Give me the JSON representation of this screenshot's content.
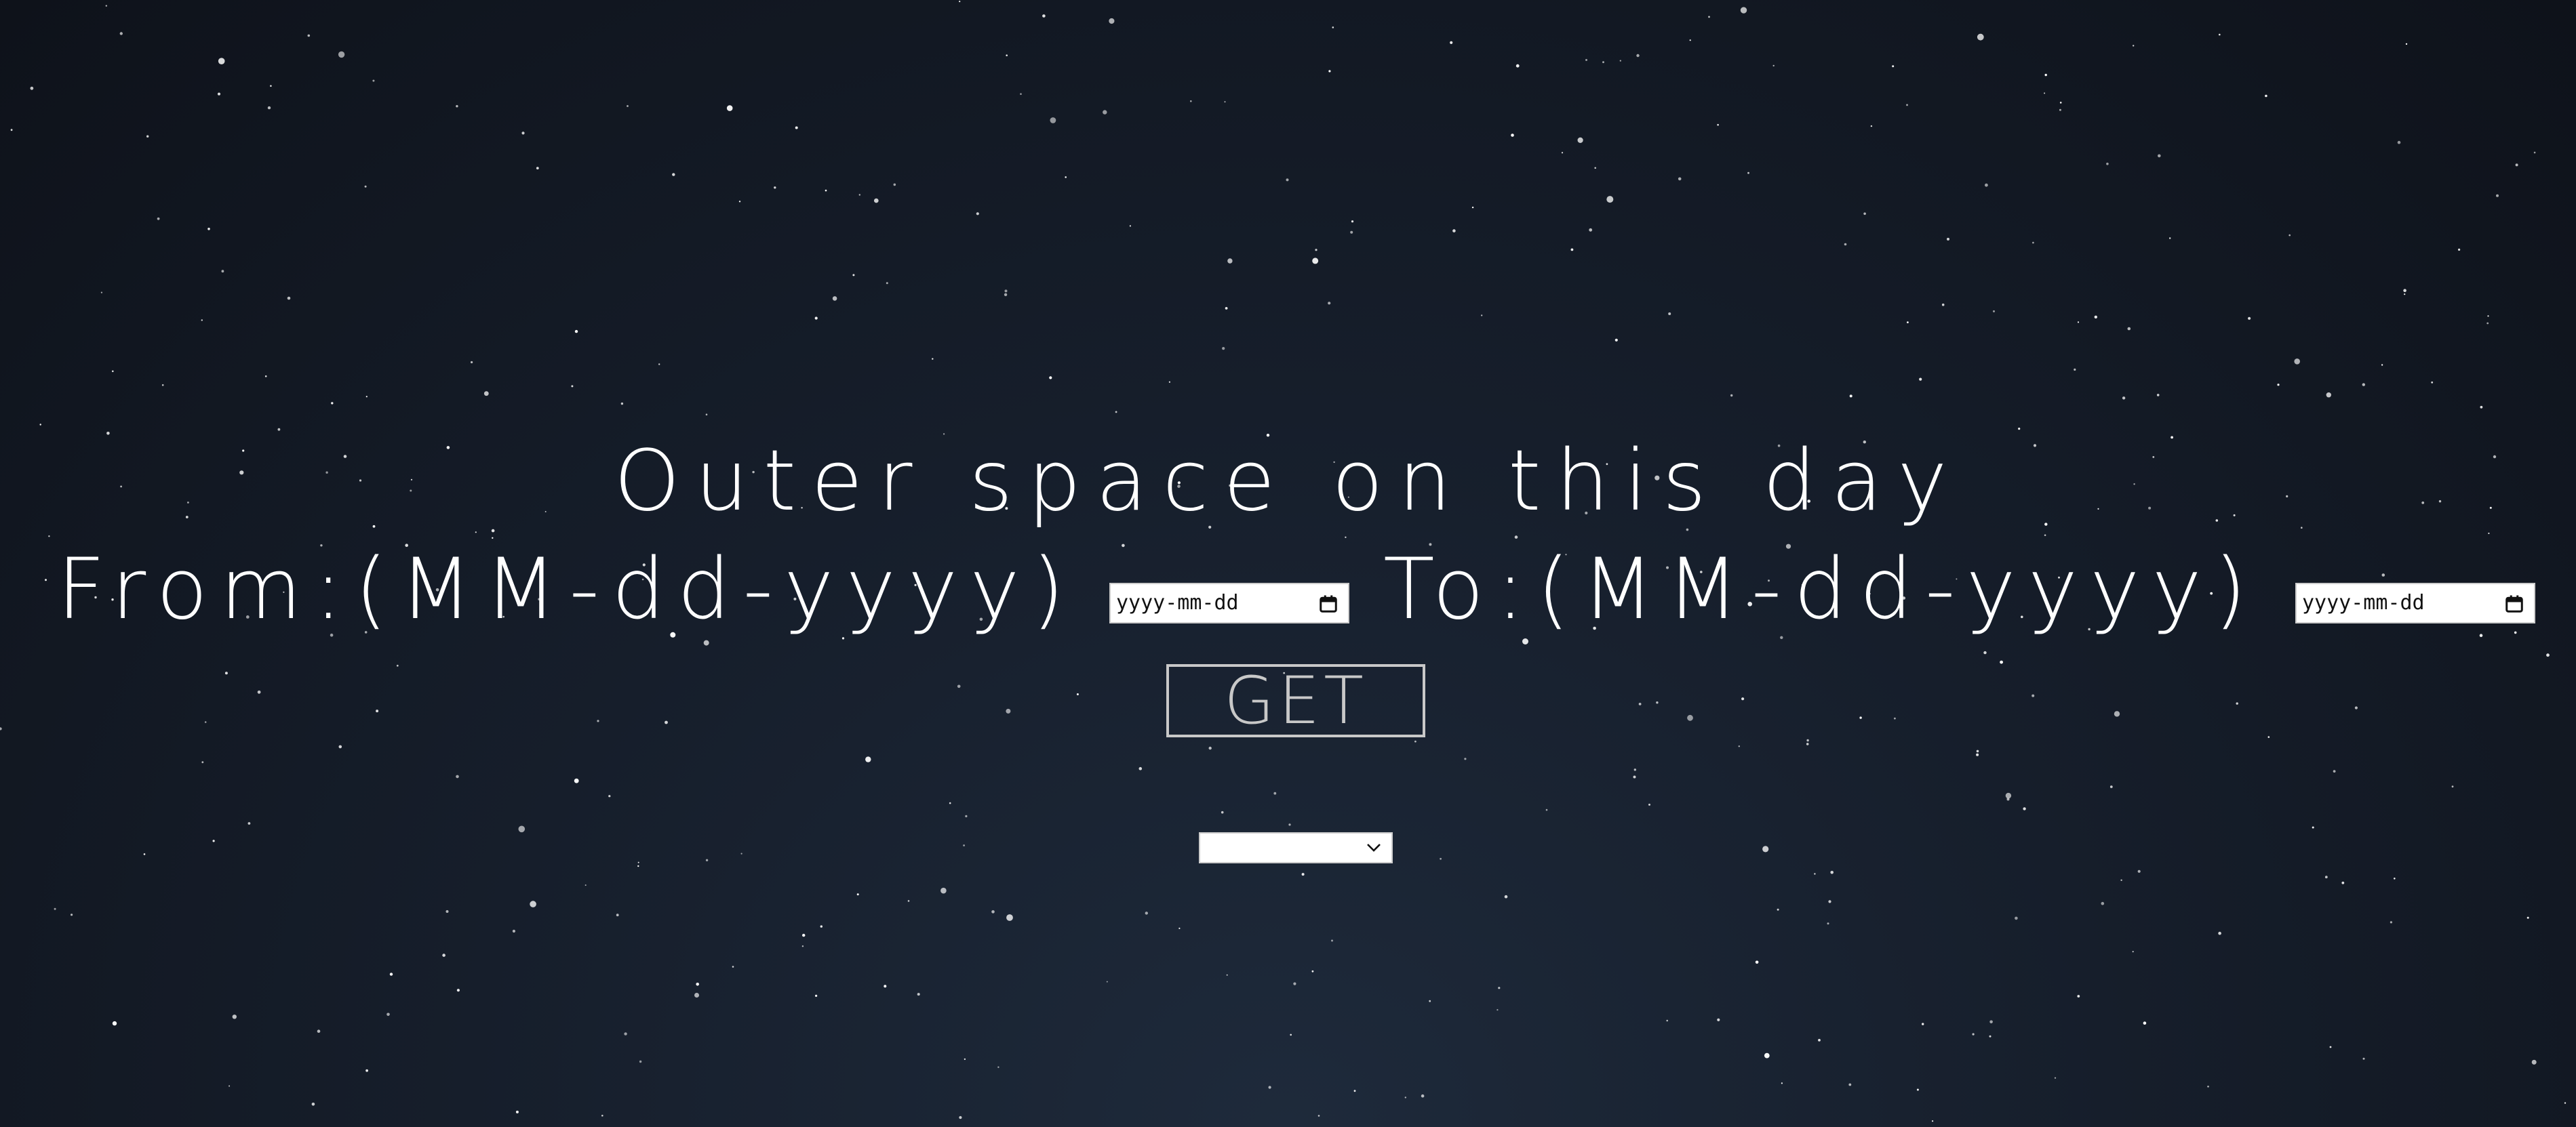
{
  "page": {
    "title": "Outer space on this day"
  },
  "date_range": {
    "from_label": "From:(MM-dd-yyyy)",
    "from_placeholder": "yyyy-mm-dd",
    "to_label": "To:(MM-dd-yyyy)",
    "to_placeholder": "yyyy-mm-dd"
  },
  "actions": {
    "get_label": "GET"
  },
  "result_select": {
    "selected": ""
  },
  "icons": {
    "date_picker": "calendar-icon",
    "select_arrow": "chevron-down-icon"
  },
  "colors": {
    "background_top": "#0e121a",
    "background_center": "#1e2a3b",
    "text": "#ffffff",
    "button_border": "#c8c8c8"
  }
}
